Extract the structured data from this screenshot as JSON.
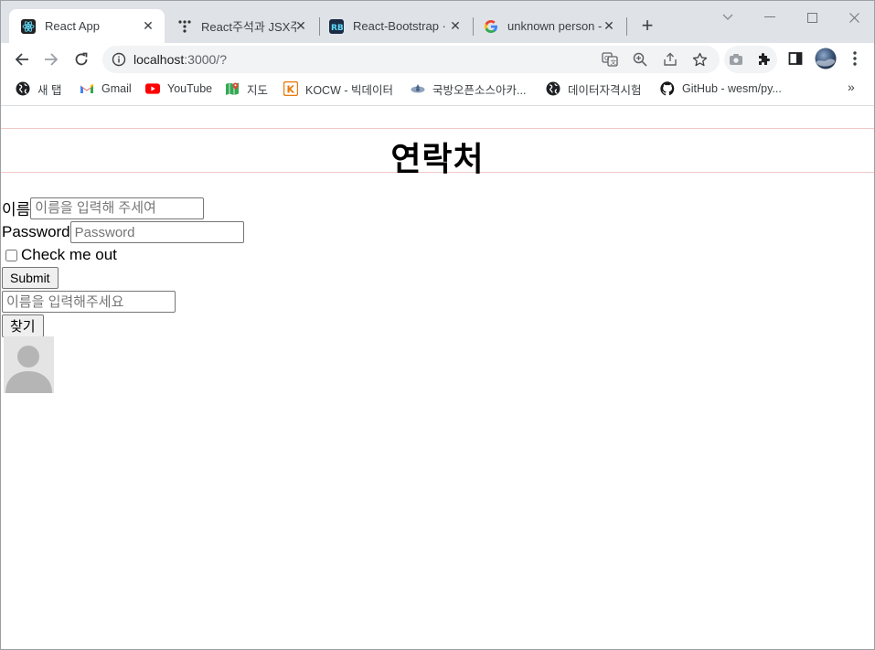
{
  "browser": {
    "tabs": [
      {
        "title": "React App",
        "active": true
      },
      {
        "title": "React주석과 JSX주",
        "active": false
      },
      {
        "title": "React-Bootstrap · I",
        "active": false
      },
      {
        "title": "unknown person -",
        "active": false
      }
    ],
    "url": {
      "host": "localhost",
      "rest": ":3000/?"
    },
    "bookmarks": [
      {
        "label": "새 탭",
        "icon": "globe-icon"
      },
      {
        "label": "Gmail",
        "icon": "gmail-icon"
      },
      {
        "label": "YouTube",
        "icon": "youtube-icon"
      },
      {
        "label": "지도",
        "icon": "maps-icon"
      },
      {
        "label": "KOCW - 빅데이터",
        "icon": "kocw-icon"
      },
      {
        "label": "국방오픈소스아카...",
        "icon": "academy-icon"
      },
      {
        "label": "데이터자격시험",
        "icon": "globe-icon"
      },
      {
        "label": "GitHub - wesm/py...",
        "icon": "github-icon"
      }
    ],
    "bookmarks_more": "»"
  },
  "page": {
    "title": "연락처",
    "name_label": "이름",
    "name_placeholder": "이름을 입력해 주세여",
    "password_label": "Password",
    "password_placeholder": "Password",
    "checkbox_label": "Check me out",
    "submit_label": "Submit",
    "search_placeholder": "이름을 입력해주세요",
    "find_label": "찾기"
  },
  "colors": {
    "tabstrip": "#dfe3e8",
    "header_border": "#f0c8c8",
    "avatar_bg": "#e4e4e4",
    "avatar_fg": "#b5b5b5"
  }
}
